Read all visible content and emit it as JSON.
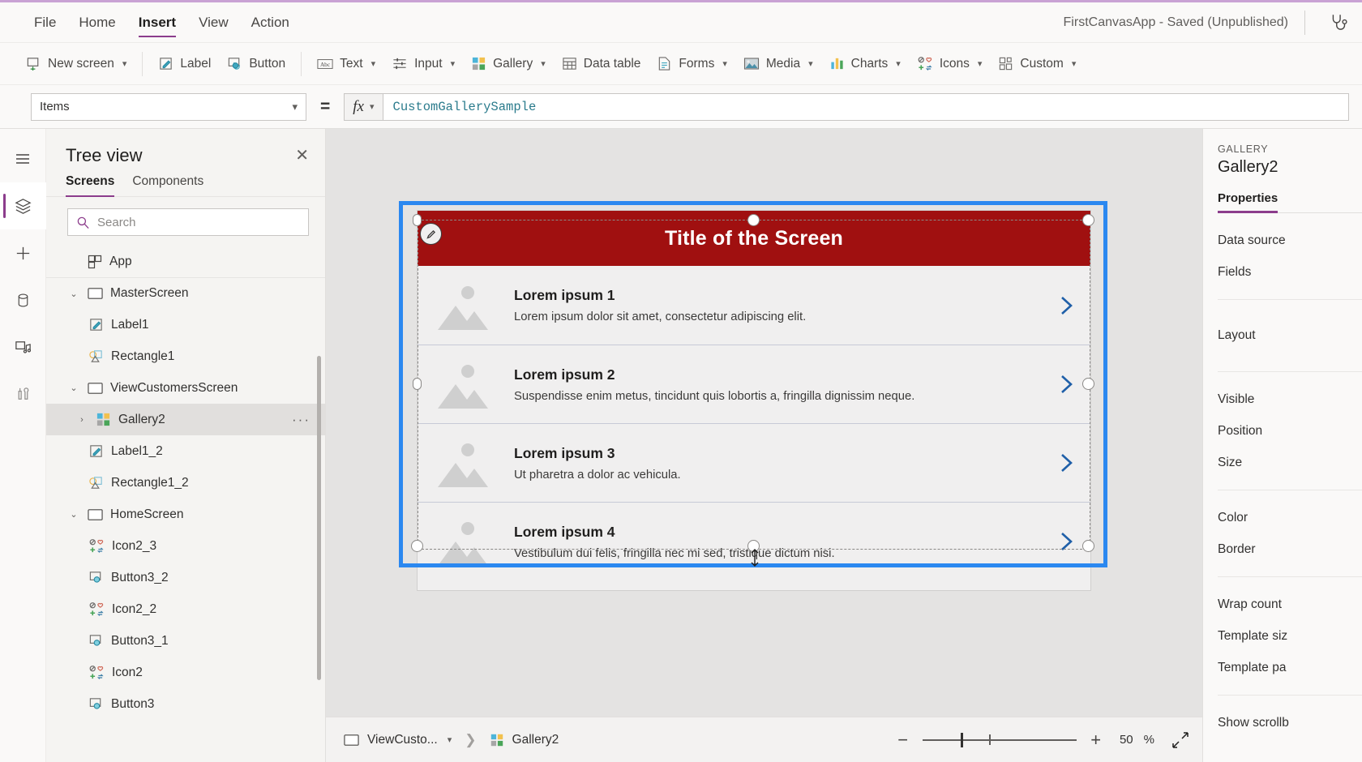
{
  "menu": {
    "items": [
      {
        "label": "File",
        "active": false
      },
      {
        "label": "Home",
        "active": false
      },
      {
        "label": "Insert",
        "active": true
      },
      {
        "label": "View",
        "active": false
      },
      {
        "label": "Action",
        "active": false
      }
    ],
    "app_title": "FirstCanvasApp - Saved (Unpublished)",
    "help_icon": "stethoscope-icon"
  },
  "ribbon": {
    "groups": [
      [
        {
          "label": "New screen",
          "icon": "new-screen-icon",
          "caret": true
        }
      ],
      [
        {
          "label": "Label",
          "icon": "label-icon",
          "caret": false
        },
        {
          "label": "Button",
          "icon": "button-icon",
          "caret": false
        }
      ],
      [
        {
          "label": "Text",
          "icon": "text-icon",
          "caret": true
        },
        {
          "label": "Input",
          "icon": "input-icon",
          "caret": true
        },
        {
          "label": "Gallery",
          "icon": "gallery-icon",
          "caret": true
        },
        {
          "label": "Data table",
          "icon": "data-table-icon",
          "caret": false
        },
        {
          "label": "Forms",
          "icon": "forms-icon",
          "caret": true
        },
        {
          "label": "Media",
          "icon": "media-icon",
          "caret": true
        },
        {
          "label": "Charts",
          "icon": "charts-icon",
          "caret": true
        },
        {
          "label": "Icons",
          "icon": "icons-icon",
          "caret": true
        },
        {
          "label": "Custom",
          "icon": "custom-icon",
          "caret": true
        }
      ]
    ]
  },
  "formula_bar": {
    "property": "Items",
    "equals": "=",
    "fx_label": "fx",
    "formula": "CustomGallerySample"
  },
  "rail": {
    "items": [
      {
        "name": "hamburger-menu-icon",
        "active": false
      },
      {
        "name": "tree-view-layers-icon",
        "active": true
      },
      {
        "name": "insert-plus-icon",
        "active": false
      },
      {
        "name": "data-cylinder-icon",
        "active": false
      },
      {
        "name": "media-icon",
        "active": false
      },
      {
        "name": "advanced-tools-icon",
        "active": false
      }
    ]
  },
  "tree_view": {
    "title": "Tree view",
    "close_label": "✕",
    "tabs": [
      {
        "label": "Screens",
        "active": true
      },
      {
        "label": "Components",
        "active": false
      }
    ],
    "search_placeholder": "Search",
    "items": [
      {
        "label": "App",
        "level": 0,
        "icon": "app-icon",
        "caret": "",
        "selected": false,
        "sep": false
      },
      {
        "label": "MasterScreen",
        "level": 0,
        "icon": "screen-icon",
        "caret": "⌄",
        "selected": false,
        "sep": true
      },
      {
        "label": "Label1",
        "level": 1,
        "icon": "label-icon",
        "caret": "",
        "selected": false,
        "sep": false
      },
      {
        "label": "Rectangle1",
        "level": 1,
        "icon": "shape-icon",
        "caret": "",
        "selected": false,
        "sep": false
      },
      {
        "label": "ViewCustomersScreen",
        "level": 0,
        "icon": "screen-icon",
        "caret": "⌄",
        "selected": false,
        "sep": false
      },
      {
        "label": "Gallery2",
        "level": 1,
        "icon": "gallery-icon",
        "caret": "›",
        "selected": true,
        "sep": false,
        "dots": "···"
      },
      {
        "label": "Label1_2",
        "level": 1,
        "icon": "label-icon",
        "caret": "",
        "selected": false,
        "sep": false
      },
      {
        "label": "Rectangle1_2",
        "level": 1,
        "icon": "shape-icon",
        "caret": "",
        "selected": false,
        "sep": false
      },
      {
        "label": "HomeScreen",
        "level": 0,
        "icon": "screen-icon",
        "caret": "⌄",
        "selected": false,
        "sep": false
      },
      {
        "label": "Icon2_3",
        "level": 1,
        "icon": "icons-icon",
        "caret": "",
        "selected": false,
        "sep": false
      },
      {
        "label": "Button3_2",
        "level": 1,
        "icon": "button-icon",
        "caret": "",
        "selected": false,
        "sep": false
      },
      {
        "label": "Icon2_2",
        "level": 1,
        "icon": "icons-icon",
        "caret": "",
        "selected": false,
        "sep": false
      },
      {
        "label": "Button3_1",
        "level": 1,
        "icon": "button-icon",
        "caret": "",
        "selected": false,
        "sep": false
      },
      {
        "label": "Icon2",
        "level": 1,
        "icon": "icons-icon",
        "caret": "",
        "selected": false,
        "sep": false
      },
      {
        "label": "Button3",
        "level": 1,
        "icon": "button-icon",
        "caret": "",
        "selected": false,
        "sep": false
      }
    ]
  },
  "canvas": {
    "screen_title": "Title of the Screen",
    "title_bg": "#a01010",
    "selection_color": "#2b88f0",
    "gallery_items": [
      {
        "title": "Lorem ipsum 1",
        "subtitle": "Lorem ipsum dolor sit amet, consectetur adipiscing elit."
      },
      {
        "title": "Lorem ipsum 2",
        "subtitle": "Suspendisse enim metus, tincidunt quis lobortis a, fringilla dignissim neque."
      },
      {
        "title": "Lorem ipsum 3",
        "subtitle": "Ut pharetra a dolor ac vehicula."
      },
      {
        "title": "Lorem ipsum 4",
        "subtitle": "Vestibulum dui felis, fringilla nec mi sed, tristique dictum nisi."
      }
    ],
    "arrow_icon": "chevron-right-icon",
    "arrow_color": "#1f5fa8"
  },
  "bottom_bar": {
    "screen_crumb": "ViewCusto...",
    "control_crumb": "Gallery2",
    "zoom_minus": "−",
    "zoom_plus": "+",
    "zoom_value": "50",
    "zoom_unit": "%",
    "fit_icon": "fit-to-screen-icon"
  },
  "properties_panel": {
    "kicker": "GALLERY",
    "control_name": "Gallery2",
    "tab": "Properties",
    "groups": [
      [
        "Data source",
        "Fields"
      ],
      [
        "Layout"
      ],
      [
        "Visible",
        "Position",
        "Size"
      ],
      [
        "Color",
        "Border"
      ],
      [
        "Wrap count",
        "Template siz",
        "Template pa"
      ],
      [
        "Show scrollb"
      ]
    ]
  }
}
